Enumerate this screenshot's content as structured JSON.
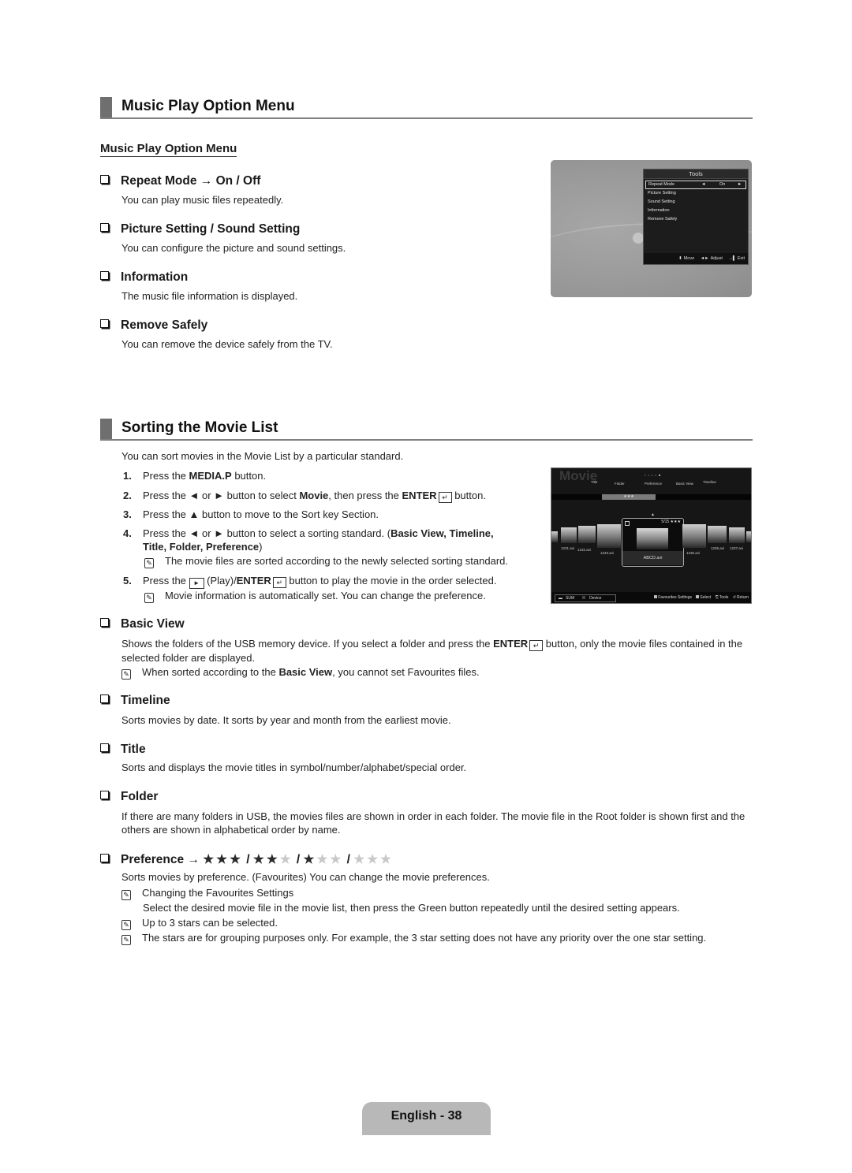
{
  "section1": {
    "title": "Music Play Option Menu",
    "subheading": "Music Play Option Menu",
    "items": [
      {
        "heading": "Repeat Mode → On / Off",
        "desc": "You can play music files repeatedly."
      },
      {
        "heading": "Picture Setting / Sound Setting",
        "desc": "You can configure the picture and sound settings."
      },
      {
        "heading": "Information",
        "desc": "The music file information is displayed."
      },
      {
        "heading": "Remove Safely",
        "desc": "You can remove the device safely from the TV."
      }
    ]
  },
  "tools_screen": {
    "title": "Tools",
    "items": [
      {
        "label": "Repeat Mode",
        "value": "On",
        "selected": true
      },
      {
        "label": "Picture Setting"
      },
      {
        "label": "Sound Setting"
      },
      {
        "label": "Information"
      },
      {
        "label": "Remove Safely"
      }
    ],
    "arrow_left": "◄",
    "arrow_right": "►",
    "footer": {
      "move": "Move",
      "adjust": "Adjust",
      "exit": "Exit",
      "move_icon": "⬍",
      "adjust_icon": "◄►",
      "exit_icon": "→▌"
    }
  },
  "section2": {
    "title": "Sorting the Movie List",
    "intro": "You can sort movies in the Movie List by a particular standard.",
    "steps": [
      {
        "num": "1.",
        "pre": "Press the ",
        "bold": "MEDIA.P",
        "post": " button."
      },
      {
        "num": "2.",
        "pre": "Press the ◄ or ► button to select ",
        "bold": "Movie",
        "mid": ", then press the ",
        "bold2": "ENTER",
        "post": " button."
      },
      {
        "num": "3.",
        "text": "Press the ▲ button to move to the Sort key Section."
      },
      {
        "num": "4.",
        "pre": "Press the ◄ or ► button to select a sorting standard. (",
        "bold": "Basic View, Timeline,",
        "line2_bold": "Title, Folder, Preference",
        "line2_post": ")",
        "note": "The movie files are sorted according to the newly selected sorting standard."
      },
      {
        "num": "5.",
        "pre": "Press the ",
        "play": "►",
        "mid": " (Play)/",
        "bold": "ENTER",
        "post": " button to play the movie in the order selected.",
        "note": "Movie information is automatically set. You can change the preference."
      }
    ],
    "enter_icon": "↵",
    "note_icon": "✎"
  },
  "movie_screen": {
    "logo": "Movie",
    "page_dots": "• • • • ■",
    "sort_tabs": [
      "Title",
      "Folder",
      "Preference",
      "Basic View",
      "Timeline"
    ],
    "sort_selected_value": "★★★",
    "files": [
      "1231.avi",
      "1232.avi",
      "1233.avi",
      "ABCD.avi",
      "1235.avi",
      "1236.avi",
      "1237.avi"
    ],
    "focused": {
      "name": "ABCD.avi",
      "rating": "5/15 ★★★"
    },
    "footer": {
      "device_sum": "SUM",
      "device_label": "Device",
      "favourites": "Favourites Settings",
      "select": "Select",
      "tools": "Tools",
      "return": "Return"
    }
  },
  "options": [
    {
      "heading": "Basic View",
      "desc_pre": "Shows the folders of the USB memory device. If you select a folder and press the ",
      "desc_bold": "ENTER",
      "desc_post": " button, only the movie files contained in the selected folder are displayed.",
      "note_pre": "When sorted according to the ",
      "note_bold": "Basic View",
      "note_post": ", you cannot set Favourites files."
    },
    {
      "heading": "Timeline",
      "desc": "Sorts movies by date. It sorts by year and month from the earliest movie."
    },
    {
      "heading": "Title",
      "desc": "Sorts and displays the movie titles in symbol/number/alphabet/special order."
    },
    {
      "heading": "Folder",
      "desc": "If there are many folders in USB, the movies files are shown in order in each folder. The movie file in the Root folder is shown first and the others are shown in alphabetical order by name."
    },
    {
      "heading": "Preference →",
      "star_levels": [
        3,
        2,
        1,
        0
      ],
      "star_max": 3,
      "desc": "Sorts movies by preference. (Favourites) You can change the movie preferences.",
      "notes": [
        {
          "title": "Changing the Favourites Settings",
          "text": "Select the desired movie file in the movie list, then press the Green button repeatedly until the desired setting appears."
        },
        {
          "title": "Up to 3 stars can be selected."
        },
        {
          "title": "The stars are for grouping purposes only. For example, the 3 star setting does not have any priority over the one star setting."
        }
      ]
    }
  ],
  "footer": {
    "page_label": "English - 38"
  }
}
